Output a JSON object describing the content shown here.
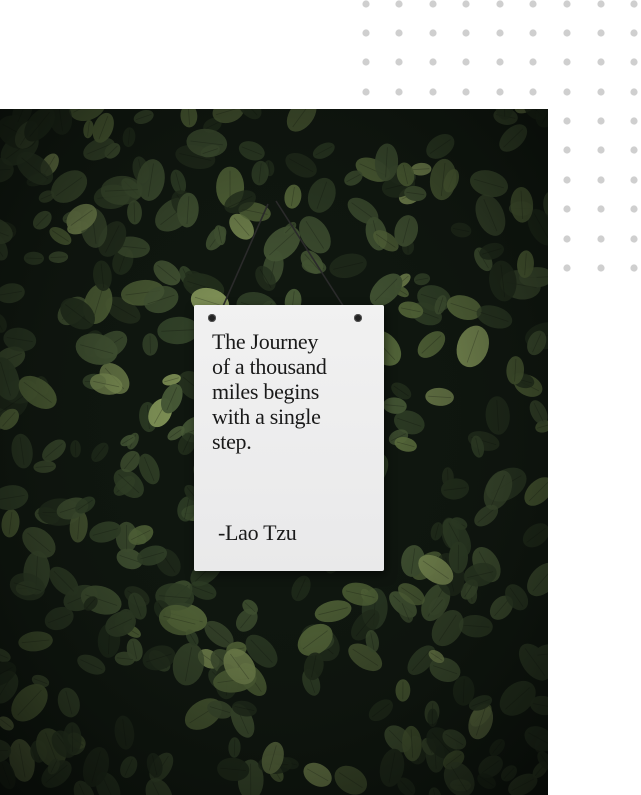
{
  "sign": {
    "quote_lines": [
      "The Journey",
      "of a thousand",
      "miles begins",
      "with a single",
      "step."
    ],
    "author": "-Lao Tzu"
  },
  "colors": {
    "background": "#ffffff",
    "dots": "#cfcfcf",
    "foliage_dark": "#0b110c",
    "leaf_light": "#9fb46a",
    "leaf_mid": "#52663e",
    "leaf_dark": "#26331f",
    "sign": "#efefef",
    "text": "#1a1a1a"
  }
}
